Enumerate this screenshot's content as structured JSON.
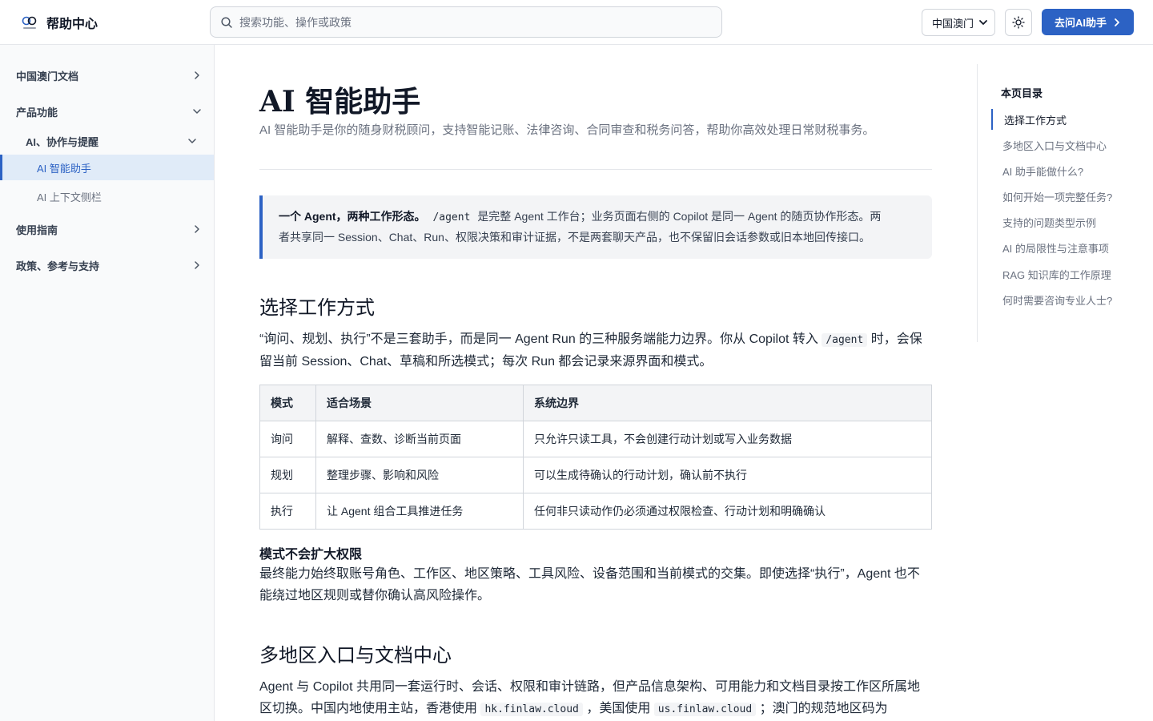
{
  "header": {
    "brand_title": "帮助中心",
    "search_placeholder": "搜索功能、操作或政策",
    "region_value": "中国澳门",
    "ask_button_label": "去问AI助手"
  },
  "sidebar": {
    "items": [
      {
        "label": "中国澳门文档"
      },
      {
        "label": "产品功能"
      },
      {
        "label": "AI、协作与提醒"
      },
      {
        "label": "AI 智能助手"
      },
      {
        "label": "AI 上下文侧栏"
      },
      {
        "label": "使用指南"
      },
      {
        "label": "政策、参考与支持"
      }
    ]
  },
  "main": {
    "title": "AI 智能助手",
    "description": "AI 智能助手是你的随身财税顾问，支持智能记账、法律咨询、合同审查和税务问答，帮助你高效处理日常财税事务。",
    "callout": {
      "bold": "一个 Agent，两种工作形态。",
      "code": "/agent",
      "text_line1": "是完整 Agent 工作台；业务页面右侧的 Copilot 是同一 Agent 的随页协作形态。两",
      "text_line2": "者共享同一 Session、Chat、Run、权限决策和审计证据，不是两套聊天产品，也不保留旧会话参数或旧本地回传接口。"
    },
    "section1": {
      "heading": "选择工作方式",
      "para_a": "“询问、规划、执行”不是三套助手，而是同一 Agent Run 的三种服务端能力边界。你从 Copilot 转入",
      "para_code": "/agent",
      "para_b": "时，会保",
      "para_line2": "留当前 Session、Chat、草稿和所选模式；每次 Run 都会记录来源界面和模式。"
    },
    "table": {
      "headers": [
        "模式",
        "适合场景",
        "系统边界"
      ],
      "rows": [
        [
          "询问",
          "解释、查数、诊断当前页面",
          "只允许只读工具，不会创建行动计划或写入业务数据"
        ],
        [
          "规划",
          "整理步骤、影响和风险",
          "可以生成待确认的行动计划，确认前不执行"
        ],
        [
          "执行",
          "让 Agent 组合工具推进任务",
          "任何非只读动作仍必须通过权限检查、行动计划和明确确认"
        ]
      ]
    },
    "note": {
      "title": "模式不会扩大权限",
      "line1": "最终能力始终取账号角色、工作区、地区策略、工具风险、设备范围和当前模式的交集。即使选择“执行”，Agent 也不",
      "line2": "能绕过地区规则或替你确认高风险操作。"
    },
    "section2": {
      "heading": "多地区入口与文档中心",
      "line1": "Agent 与 Copilot 共用同一套运行时、会话、权限和审计链路，但产品信息架构、可用能力和文档目录按工作区所属地",
      "line2_a": "区切换。中国内地使用主站，香港使用",
      "code1": "hk.finlaw.cloud",
      "line2_b": "，美国使用",
      "code2": "us.finlaw.cloud",
      "line2_c": "；澳门的规范地区码为"
    }
  },
  "toc": {
    "title": "本页目录",
    "items": [
      {
        "label": "选择工作方式"
      },
      {
        "label": "多地区入口与文档中心"
      },
      {
        "label": "AI 助手能做什么?"
      },
      {
        "label": "如何开始一项完整任务?"
      },
      {
        "label": "支持的问题类型示例"
      },
      {
        "label": "AI 的局限性与注意事项"
      },
      {
        "label": "RAG 知识库的工作原理"
      },
      {
        "label": "何时需要咨询专业人士?"
      }
    ]
  },
  "colors": {
    "accent": "#2c62c4",
    "active_bg": "#e0ebf8"
  }
}
